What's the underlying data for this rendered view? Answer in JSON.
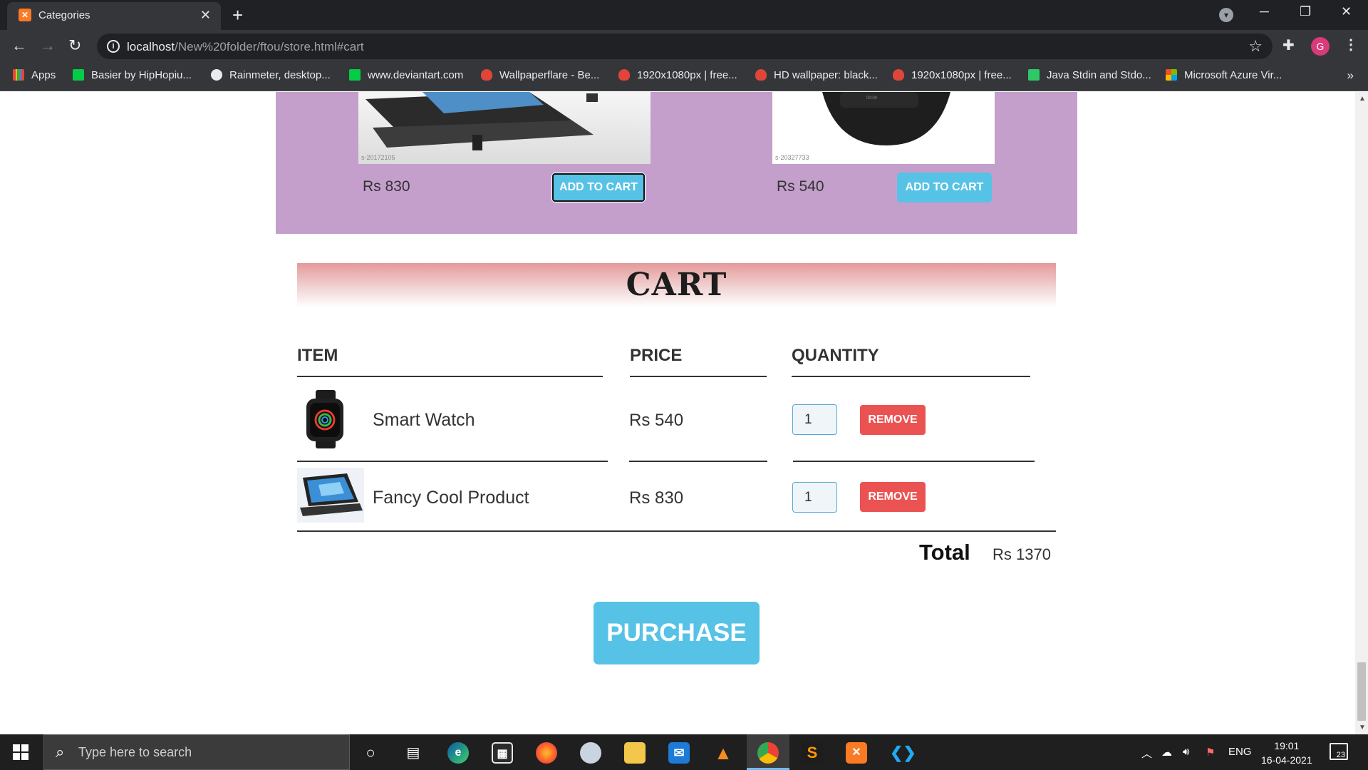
{
  "browser": {
    "tab_title": "Categories",
    "tab_favicon": "xampp-icon",
    "url_host": "localhost",
    "url_path": "/New%20folder/ftou/store.html#cart",
    "bookmarks": [
      {
        "label": "Apps",
        "icon": "apps-grid-icon",
        "color": "#ea4335"
      },
      {
        "label": "Basier by HipHopiu...",
        "icon": "deviantart-icon",
        "color": "#05cc47"
      },
      {
        "label": "Rainmeter, desktop...",
        "icon": "rainmeter-icon",
        "color": "#e8eaed"
      },
      {
        "label": "www.deviantart.com",
        "icon": "deviantart-icon",
        "color": "#05cc47"
      },
      {
        "label": "Wallpaperflare - Be...",
        "icon": "flame-icon",
        "color": "#e0453a"
      },
      {
        "label": "1920x1080px | free...",
        "icon": "flame-icon",
        "color": "#e0453a"
      },
      {
        "label": "HD wallpaper: black...",
        "icon": "flame-icon",
        "color": "#e0453a"
      },
      {
        "label": "1920x1080px | free...",
        "icon": "flame-icon",
        "color": "#e0453a"
      },
      {
        "label": "Java Stdin and Stdo...",
        "icon": "hackerrank-icon",
        "color": "#2ec866"
      },
      {
        "label": "Microsoft Azure Vir...",
        "icon": "microsoft-icon",
        "color": "#f25022"
      }
    ],
    "profile_initial": "G"
  },
  "store": {
    "products": [
      {
        "price": "Rs 830",
        "button": "ADD TO CART",
        "img_tag": "s-20172105"
      },
      {
        "price": "Rs 540",
        "button": "ADD TO CART",
        "img_tag": "s-20327733"
      }
    ]
  },
  "cart": {
    "title": "CART",
    "headers": {
      "item": "ITEM",
      "price": "PRICE",
      "quantity": "QUANTITY"
    },
    "rows": [
      {
        "name": "Smart Watch",
        "price": "Rs 540",
        "quantity": "1",
        "remove": "REMOVE"
      },
      {
        "name": "Fancy Cool Product",
        "price": "Rs 830",
        "quantity": "1",
        "remove": "REMOVE"
      }
    ],
    "total_label": "Total",
    "total_value": "Rs 1370",
    "purchase_label": "PURCHASE"
  },
  "colors": {
    "store_bg": "#c49fcc",
    "button_blue": "#56c2e6",
    "remove_red": "#eb5353"
  },
  "taskbar": {
    "search_placeholder": "Type here to search",
    "language": "ENG",
    "time": "19:01",
    "date": "16-04-2021",
    "notification_count": "23"
  }
}
